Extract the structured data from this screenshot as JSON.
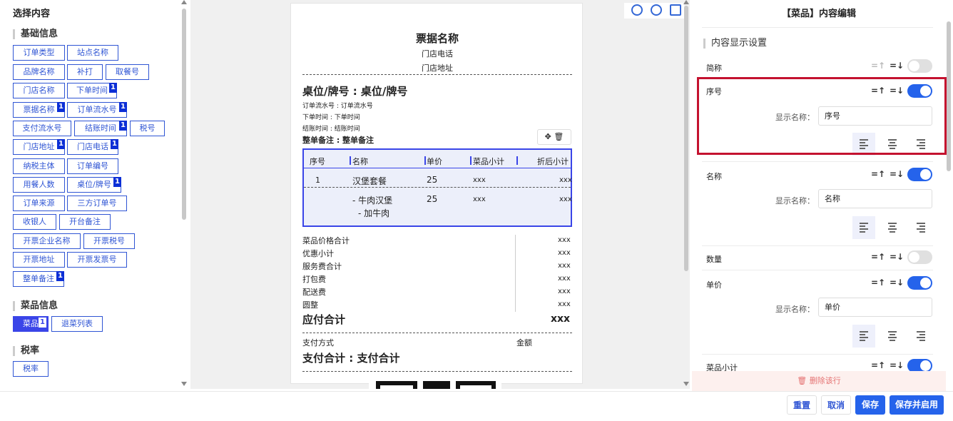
{
  "left": {
    "title": "选择内容",
    "sections": {
      "basic": "基础信息",
      "dish": "菜品信息",
      "tax": "税率"
    },
    "tags": {
      "t1": "订单类型",
      "t2": "站点名称",
      "t3": "品牌名称",
      "t4": "补打",
      "t5": "取餐号",
      "t6": "门店名称",
      "t7": "下单时间",
      "t8": "票据名称",
      "t9": "订单流水号",
      "t10": "支付流水号",
      "t11": "结账时间",
      "t12": "税号",
      "t13": "门店地址",
      "t14": "门店电话",
      "t15": "纳税主体",
      "t16": "订单编号",
      "t17": "用餐人数",
      "t18": "桌位/牌号",
      "t19": "订单来源",
      "t20": "三方订单号",
      "t21": "收银人",
      "t22": "开台备注",
      "t23": "开票企业名称",
      "t24": "开票税号",
      "t25": "开票地址",
      "t26": "开票发票号",
      "t27": "整单备注",
      "dish1": "菜品",
      "dish2": "退菜列表",
      "tax1": "税率"
    },
    "badge": "1"
  },
  "receipt": {
    "title": "票据名称",
    "phone": "门店电话",
    "address": "门店地址",
    "table": "桌位/牌号 : 桌位/牌号",
    "serial": "订单流水号 : 订单流水号",
    "order_time": "下单时间 : 下单时间",
    "checkout_time": "结账时间 : 结账时间",
    "remark": "整单备注 : 整单备注",
    "headers": {
      "h1": "序号",
      "h2": "名称",
      "h3": "单价",
      "h4": "菜品小计",
      "h5": "折后小计"
    },
    "row1": {
      "no": "1",
      "name": "汉堡套餐",
      "price": "25",
      "sub": "xxx",
      "after": "xxx"
    },
    "row2": {
      "name": "- 牛肉汉堡",
      "sub_name": "- 加牛肉",
      "price": "25",
      "sub": "xxx",
      "after": "xxx"
    },
    "totals": [
      {
        "label": "菜品价格合计",
        "value": "xxx"
      },
      {
        "label": "优惠小计",
        "value": "xxx"
      },
      {
        "label": "服务费合计",
        "value": "xxx"
      },
      {
        "label": "打包费",
        "value": "xxx"
      },
      {
        "label": "配送费",
        "value": "xxx"
      },
      {
        "label": "圆整",
        "value": "xxx"
      }
    ],
    "payable_label": "应付合计",
    "payable_value": "xxx",
    "pay_method": "支付方式",
    "amount": "金额",
    "paid_total": "支付合计 : 支付合计"
  },
  "right": {
    "title": "【菜品】内容编辑",
    "section": "内容显示设置",
    "items": {
      "abbr": "简称",
      "seq": "序号",
      "name": "名称",
      "qty": "数量",
      "price": "单价",
      "subtotal": "菜品小计"
    },
    "display_name_label": "显示名称：",
    "seq_value": "序号",
    "name_value": "名称",
    "price_value": "单价",
    "delete_row": "删除该行"
  },
  "buttons": {
    "reset": "重置",
    "cancel": "取消",
    "save": "保存",
    "save_enable": "保存并启用"
  },
  "colors": {
    "accent": "#2563eb",
    "highlight": "#c4122f"
  }
}
